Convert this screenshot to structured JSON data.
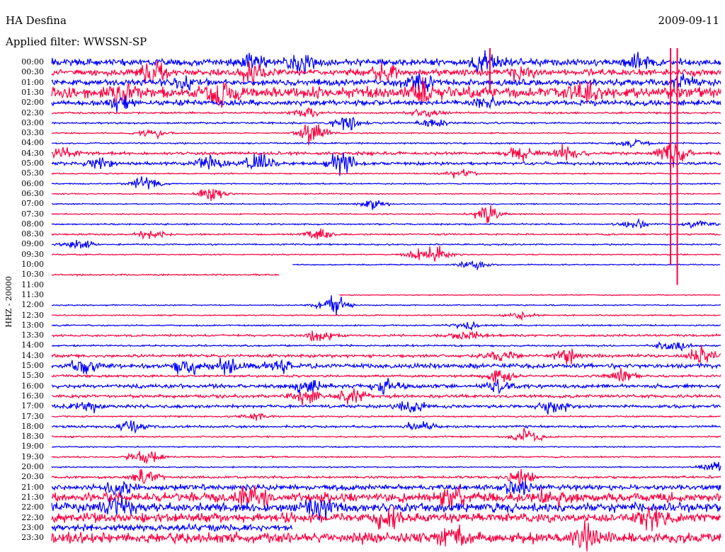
{
  "header": {
    "station": "HA Desfina",
    "filter": "Applied filter: WWSSN-SP",
    "date": "2009-09-11"
  },
  "chart_data": {
    "type": "line",
    "title": "HA Desfina",
    "subtitle": "Applied filter: WWSSN-SP",
    "date": "2009-09-11",
    "ylabel": "HHZ - 20000",
    "xlabel": "",
    "colors": {
      "blue": "#0000ff",
      "red": "#ff0040"
    },
    "rows": [
      {
        "label": "00:00",
        "color": "#0000ff",
        "amp": 0.45,
        "start": 0,
        "end": 1,
        "bursts": [
          [
            0.3,
            1.2
          ],
          [
            0.37,
            1.0
          ],
          [
            0.65,
            1.3
          ],
          [
            0.88,
            1.0
          ]
        ]
      },
      {
        "label": "00:30",
        "color": "#ff0040",
        "amp": 0.4,
        "start": 0,
        "end": 1,
        "bursts": [
          [
            0.15,
            1.4
          ],
          [
            0.3,
            1.2
          ],
          [
            0.5,
            1.0
          ],
          [
            0.7,
            0.8
          ]
        ]
      },
      {
        "label": "01:00",
        "color": "#0000ff",
        "amp": 0.4,
        "start": 0,
        "end": 1,
        "bursts": [
          [
            0.2,
            1.0
          ],
          [
            0.55,
            1.2
          ],
          [
            0.95,
            0.8
          ]
        ]
      },
      {
        "label": "01:30",
        "color": "#ff0040",
        "amp": 0.7,
        "start": 0,
        "end": 1,
        "bursts": [
          [
            0.1,
            1.2
          ],
          [
            0.25,
            1.3
          ],
          [
            0.55,
            1.2
          ],
          [
            0.8,
            1.0
          ]
        ]
      },
      {
        "label": "02:00",
        "color": "#0000ff",
        "amp": 0.35,
        "start": 0,
        "end": 1,
        "bursts": [
          [
            0.1,
            0.8
          ],
          [
            0.65,
            0.6
          ]
        ]
      },
      {
        "label": "02:30",
        "color": "#ff0040",
        "amp": 0.12,
        "start": 0,
        "end": 1,
        "bursts": [
          [
            0.38,
            0.8
          ],
          [
            0.56,
            0.5
          ]
        ]
      },
      {
        "label": "03:00",
        "color": "#0000ff",
        "amp": 0.12,
        "start": 0,
        "end": 1,
        "bursts": [
          [
            0.44,
            1.0
          ],
          [
            0.57,
            0.5
          ]
        ]
      },
      {
        "label": "03:30",
        "color": "#ff0040",
        "amp": 0.08,
        "start": 0,
        "end": 1,
        "bursts": [
          [
            0.15,
            0.6
          ],
          [
            0.39,
            1.4
          ]
        ]
      },
      {
        "label": "04:00",
        "color": "#0000ff",
        "amp": 0.1,
        "start": 0,
        "end": 1,
        "bursts": [
          [
            0.87,
            0.7
          ]
        ]
      },
      {
        "label": "04:30",
        "color": "#ff0040",
        "amp": 0.2,
        "start": 0,
        "end": 1,
        "bursts": [
          [
            0.02,
            0.8
          ],
          [
            0.7,
            1.0
          ],
          [
            0.77,
            1.0
          ],
          [
            0.93,
            1.5
          ]
        ]
      },
      {
        "label": "05:00",
        "color": "#0000ff",
        "amp": 0.2,
        "start": 0,
        "end": 1,
        "bursts": [
          [
            0.07,
            0.7
          ],
          [
            0.24,
            1.0
          ],
          [
            0.31,
            1.2
          ],
          [
            0.43,
            1.6
          ]
        ]
      },
      {
        "label": "05:30",
        "color": "#ff0040",
        "amp": 0.08,
        "start": 0,
        "end": 1,
        "bursts": [
          [
            0.61,
            0.6
          ]
        ]
      },
      {
        "label": "06:00",
        "color": "#0000ff",
        "amp": 0.08,
        "start": 0,
        "end": 1,
        "bursts": [
          [
            0.14,
            0.8
          ]
        ]
      },
      {
        "label": "06:30",
        "color": "#ff0040",
        "amp": 0.08,
        "start": 0,
        "end": 1,
        "bursts": [
          [
            0.24,
            0.9
          ]
        ]
      },
      {
        "label": "07:00",
        "color": "#0000ff",
        "amp": 0.08,
        "start": 0,
        "end": 1,
        "bursts": [
          [
            0.48,
            0.6
          ]
        ]
      },
      {
        "label": "07:30",
        "color": "#ff0040",
        "amp": 0.08,
        "start": 0,
        "end": 1,
        "bursts": [
          [
            0.65,
            1.2
          ]
        ]
      },
      {
        "label": "08:00",
        "color": "#0000ff",
        "amp": 0.1,
        "start": 0,
        "end": 1,
        "bursts": [
          [
            0.87,
            0.6
          ],
          [
            0.97,
            0.5
          ]
        ]
      },
      {
        "label": "08:30",
        "color": "#ff0040",
        "amp": 0.1,
        "start": 0,
        "end": 1,
        "bursts": [
          [
            0.15,
            0.6
          ],
          [
            0.4,
            0.8
          ]
        ]
      },
      {
        "label": "09:00",
        "color": "#0000ff",
        "amp": 0.1,
        "start": 0,
        "end": 1,
        "bursts": [
          [
            0.04,
            0.6
          ]
        ]
      },
      {
        "label": "09:30",
        "color": "#ff0040",
        "amp": 0.08,
        "start": 0,
        "end": 1,
        "bursts": [
          [
            0.55,
            0.7
          ],
          [
            0.58,
            0.9
          ]
        ]
      },
      {
        "label": "10:00",
        "color": "#0000ff",
        "amp": 0.08,
        "start": 0.36,
        "end": 1,
        "bursts": [
          [
            0.63,
            0.6
          ]
        ]
      },
      {
        "label": "10:30",
        "color": "#ff0040",
        "amp": 0.1,
        "start": 0,
        "end": 0.34,
        "bursts": []
      },
      {
        "label": "11:00",
        "color": "#0000ff",
        "amp": 0,
        "start": 0,
        "end": 0,
        "bursts": []
      },
      {
        "label": "11:30",
        "color": "#ff0040",
        "amp": 0.06,
        "start": 0.43,
        "end": 1,
        "bursts": []
      },
      {
        "label": "12:00",
        "color": "#0000ff",
        "amp": 0.08,
        "start": 0,
        "end": 1,
        "bursts": [
          [
            0.42,
            1.4
          ]
        ]
      },
      {
        "label": "12:30",
        "color": "#ff0040",
        "amp": 0.08,
        "start": 0,
        "end": 1,
        "bursts": [
          [
            0.7,
            0.5
          ]
        ]
      },
      {
        "label": "13:00",
        "color": "#0000ff",
        "amp": 0.1,
        "start": 0,
        "end": 1,
        "bursts": [
          [
            0.62,
            0.6
          ]
        ]
      },
      {
        "label": "13:30",
        "color": "#ff0040",
        "amp": 0.15,
        "start": 0,
        "end": 1,
        "bursts": [
          [
            0.4,
            0.8
          ],
          [
            0.62,
            0.7
          ]
        ]
      },
      {
        "label": "14:00",
        "color": "#0000ff",
        "amp": 0.12,
        "start": 0,
        "end": 1,
        "bursts": [
          [
            0.93,
            0.8
          ]
        ]
      },
      {
        "label": "14:30",
        "color": "#ff0040",
        "amp": 0.2,
        "start": 0,
        "end": 1,
        "bursts": [
          [
            0.67,
            0.9
          ],
          [
            0.77,
            0.9
          ],
          [
            0.97,
            1.0
          ]
        ]
      },
      {
        "label": "15:00",
        "color": "#0000ff",
        "amp": 0.3,
        "start": 0,
        "end": 1,
        "bursts": [
          [
            0.05,
            1.2
          ],
          [
            0.2,
            1.0
          ],
          [
            0.26,
            1.1
          ],
          [
            0.34,
            0.8
          ]
        ]
      },
      {
        "label": "15:30",
        "color": "#ff0040",
        "amp": 0.15,
        "start": 0,
        "end": 1,
        "bursts": [
          [
            0.67,
            0.8
          ],
          [
            0.85,
            0.8
          ]
        ]
      },
      {
        "label": "16:00",
        "color": "#0000ff",
        "amp": 0.25,
        "start": 0,
        "end": 1,
        "bursts": [
          [
            0.38,
            1.0
          ],
          [
            0.5,
            0.9
          ],
          [
            0.67,
            0.8
          ]
        ]
      },
      {
        "label": "16:30",
        "color": "#ff0040",
        "amp": 0.2,
        "start": 0,
        "end": 1,
        "bursts": [
          [
            0.38,
            1.0
          ],
          [
            0.45,
            1.0
          ]
        ]
      },
      {
        "label": "17:00",
        "color": "#0000ff",
        "amp": 0.2,
        "start": 0,
        "end": 1,
        "bursts": [
          [
            0.05,
            0.8
          ],
          [
            0.54,
            0.8
          ],
          [
            0.75,
            0.9
          ]
        ]
      },
      {
        "label": "17:30",
        "color": "#ff0040",
        "amp": 0.1,
        "start": 0,
        "end": 1,
        "bursts": [
          [
            0.3,
            0.5
          ]
        ]
      },
      {
        "label": "18:00",
        "color": "#0000ff",
        "amp": 0.15,
        "start": 0,
        "end": 1,
        "bursts": [
          [
            0.12,
            0.8
          ],
          [
            0.55,
            0.9
          ]
        ]
      },
      {
        "label": "18:30",
        "color": "#ff0040",
        "amp": 0.1,
        "start": 0,
        "end": 1,
        "bursts": [
          [
            0.71,
            1.2
          ]
        ]
      },
      {
        "label": "19:00",
        "color": "#0000ff",
        "amp": 0.08,
        "start": 0,
        "end": 1,
        "bursts": []
      },
      {
        "label": "19:30",
        "color": "#ff0040",
        "amp": 0.1,
        "start": 0,
        "end": 1,
        "bursts": [
          [
            0.14,
            1.4
          ]
        ]
      },
      {
        "label": "20:00",
        "color": "#0000ff",
        "amp": 0.08,
        "start": 0,
        "end": 1,
        "bursts": [
          [
            0.99,
            0.6
          ]
        ]
      },
      {
        "label": "20:30",
        "color": "#ff0040",
        "amp": 0.15,
        "start": 0,
        "end": 1,
        "bursts": [
          [
            0.14,
            0.9
          ],
          [
            0.7,
            1.0
          ]
        ]
      },
      {
        "label": "21:00",
        "color": "#0000ff",
        "amp": 0.35,
        "start": 0,
        "end": 1,
        "bursts": [
          [
            0.1,
            1.0
          ],
          [
            0.7,
            1.0
          ]
        ]
      },
      {
        "label": "21:30",
        "color": "#ff0040",
        "amp": 0.6,
        "start": 0,
        "end": 1,
        "bursts": [
          [
            0.3,
            1.2
          ],
          [
            0.6,
            1.2
          ],
          [
            0.75,
            1.2
          ]
        ]
      },
      {
        "label": "22:00",
        "color": "#0000ff",
        "amp": 0.6,
        "start": 0,
        "end": 1,
        "bursts": [
          [
            0.1,
            1.2
          ],
          [
            0.4,
            1.0
          ]
        ]
      },
      {
        "label": "22:30",
        "color": "#ff0040",
        "amp": 0.6,
        "start": 0,
        "end": 1,
        "bursts": [
          [
            0.5,
            1.2
          ],
          [
            0.9,
            1.2
          ]
        ]
      },
      {
        "label": "23:00",
        "color": "#0000ff",
        "amp": 0.4,
        "start": 0,
        "end": 0.36,
        "bursts": []
      },
      {
        "label": "23:30",
        "color": "#ff0040",
        "amp": 0.7,
        "start": 0,
        "end": 1,
        "bursts": [
          [
            0.6,
            1.3
          ],
          [
            0.8,
            1.3
          ]
        ]
      }
    ],
    "spikes": [
      {
        "x": 0.925,
        "color": "#ff0040",
        "fromRow": 0,
        "toRow": 20
      },
      {
        "x": 0.935,
        "color": "#ff0040",
        "fromRow": 0,
        "toRow": 22
      },
      {
        "x": 0.655,
        "color": "#ff0040",
        "fromRow": 0,
        "toRow": 3
      }
    ]
  }
}
